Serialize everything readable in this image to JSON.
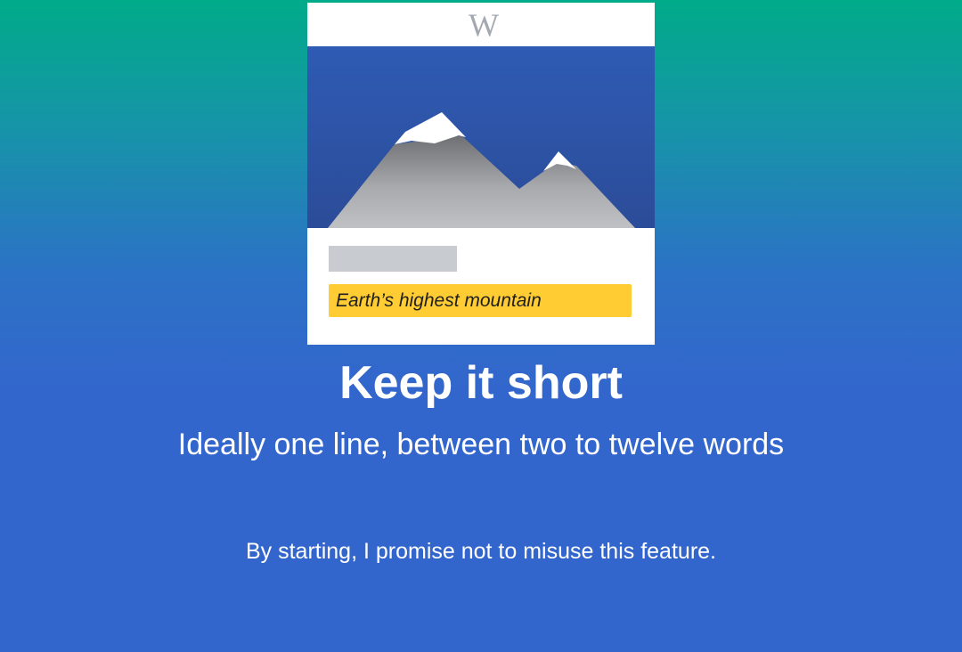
{
  "card": {
    "logo_text": "W",
    "description_text": "Earth’s highest mountain"
  },
  "onboarding": {
    "heading": "Keep it short",
    "subheading": "Ideally one line, between two to twelve words",
    "promise_text": "By starting, I promise not to misuse this feature."
  },
  "colors": {
    "background_top": "#00ab89",
    "background_bottom": "#3366cc",
    "image_sky": "#2d57ad",
    "highlight": "#ffcc33",
    "placeholder": "#c8ccd1"
  },
  "icons": {
    "logo": "wikipedia-logo-icon",
    "illustration": "mountain-illustration"
  }
}
